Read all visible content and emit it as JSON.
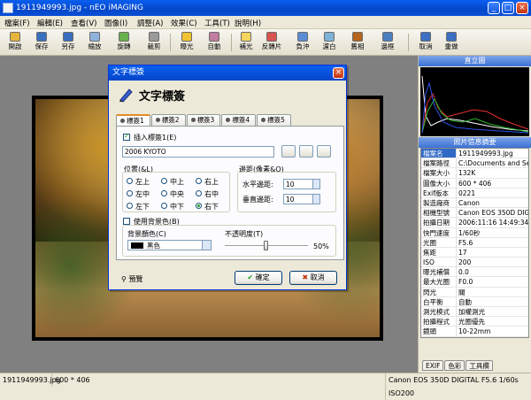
{
  "window": {
    "title": "1911949993.jpg - nEO iMAGING"
  },
  "menu": [
    "檔案(F)",
    "編輯(E)",
    "查看(V)",
    "圖像(I)",
    "調整(A)",
    "效果(C)",
    "工具(T)",
    "說明(H)"
  ],
  "toolbar": {
    "items": [
      {
        "name": "open",
        "label": "開啟",
        "icon": "folder-icon",
        "color": "#e7b53c"
      },
      {
        "name": "save",
        "label": "保存",
        "icon": "disk-icon",
        "color": "#3a6ebf"
      },
      {
        "name": "save-as",
        "label": "另存",
        "icon": "disk-as-icon",
        "color": "#3a6ebf"
      },
      {
        "name": "resize",
        "label": "縮放",
        "icon": "resize-icon",
        "color": "#8fb2dd"
      },
      {
        "name": "rotate",
        "label": "旋轉",
        "icon": "rotate-icon",
        "color": "#6ab04c"
      },
      {
        "name": "crop",
        "label": "裁剪",
        "icon": "crop-icon",
        "color": "#9a9a9a"
      },
      {
        "name": "exposure",
        "label": "曝光",
        "icon": "sun-icon",
        "color": "#f1c232"
      },
      {
        "name": "auto",
        "label": "自動",
        "icon": "wand-icon",
        "color": "#c27ba0"
      },
      {
        "name": "fill-light",
        "label": "補光",
        "icon": "bulb-icon",
        "color": "#f6d55c"
      },
      {
        "name": "cross-process",
        "label": "反轉片",
        "icon": "film-icon",
        "color": "#d9534f"
      },
      {
        "name": "negative",
        "label": "負沖",
        "icon": "negative-icon",
        "color": "#5b8dd6"
      },
      {
        "name": "filter",
        "label": "濾白",
        "icon": "filter-icon",
        "color": "#7fb3d5"
      },
      {
        "name": "sepia",
        "label": "舊相",
        "icon": "sepia-icon",
        "color": "#b5651d"
      },
      {
        "name": "border",
        "label": "邊框",
        "icon": "frame-icon",
        "color": "#4a7fbf"
      },
      {
        "name": "undo",
        "label": "取消",
        "icon": "undo-icon",
        "color": "#3d6fc2"
      },
      {
        "name": "redo",
        "label": "重做",
        "icon": "redo-icon",
        "color": "#3d6fc2"
      }
    ]
  },
  "histogram": {
    "title": "直立圖",
    "colors": {
      "red": "#e83030",
      "green": "#2fb52f",
      "blue": "#3050e8",
      "white": "#ffffff"
    }
  },
  "exif_panel": {
    "title": "照片信息摘要",
    "rows": [
      {
        "k": "檔案名",
        "v": "1911949993.jpg"
      },
      {
        "k": "檔案路徑",
        "v": "C:\\Documents and Setting"
      },
      {
        "k": "檔案大小",
        "v": "132K"
      },
      {
        "k": "圖像大小",
        "v": "600 * 406"
      },
      {
        "k": "Exif版本",
        "v": "0221"
      },
      {
        "k": "製造廠商",
        "v": "Canon"
      },
      {
        "k": "相機型號",
        "v": "Canon EOS 350D DIGIT."
      },
      {
        "k": "拍攝日期",
        "v": "2006:11:16 14:49:34"
      },
      {
        "k": "快門速度",
        "v": "1/60秒"
      },
      {
        "k": "光圈",
        "v": "F5.6"
      },
      {
        "k": "焦距",
        "v": "17"
      },
      {
        "k": "ISO",
        "v": "200"
      },
      {
        "k": "曝光補償",
        "v": "0.0"
      },
      {
        "k": "最大光圈",
        "v": "F0.0"
      },
      {
        "k": "閃光",
        "v": "關"
      },
      {
        "k": "白平衡",
        "v": "自動"
      },
      {
        "k": "測光模式",
        "v": "加權測光"
      },
      {
        "k": "拍攝程式",
        "v": "光圈優先"
      },
      {
        "k": "鏡頭",
        "v": "10-22mm"
      }
    ],
    "tabs": [
      "EXIF",
      "色彩",
      "工具欄"
    ]
  },
  "dialog": {
    "title": "文字標簽",
    "header": "文字標簽",
    "tabs": [
      "標簽1",
      "標簽2",
      "標簽3",
      "標簽4",
      "標簽5"
    ],
    "insert_label": "插入標簽1(E)",
    "text_value": "2006 KYOTO",
    "position_label": "位置(&L)",
    "positions": [
      "左上",
      "中上",
      "右上",
      "左中",
      "中央",
      "右中",
      "左下",
      "中下",
      "右下"
    ],
    "selected_position": "右下",
    "margin_label": "邊距(像素&O)",
    "h_margin_label": "水平邊距:",
    "h_margin_value": "10",
    "v_margin_label": "垂直邊距:",
    "v_margin_value": "10",
    "use_bg_label": "使用背景色(B)",
    "bg_color_label": "背景顏色(C)",
    "bg_color_value": "黑色",
    "opacity_label": "不透明度(T)",
    "opacity_value": "50%",
    "opacity_level": 0.5,
    "preview_label": "預覽",
    "ok_label": "確定",
    "cancel_label": "取消"
  },
  "status": {
    "file": "1911949993.jpg",
    "size": "600 * 406",
    "exif": "Canon EOS 350D DIGITAL F5.6 1/60s ISO200"
  }
}
